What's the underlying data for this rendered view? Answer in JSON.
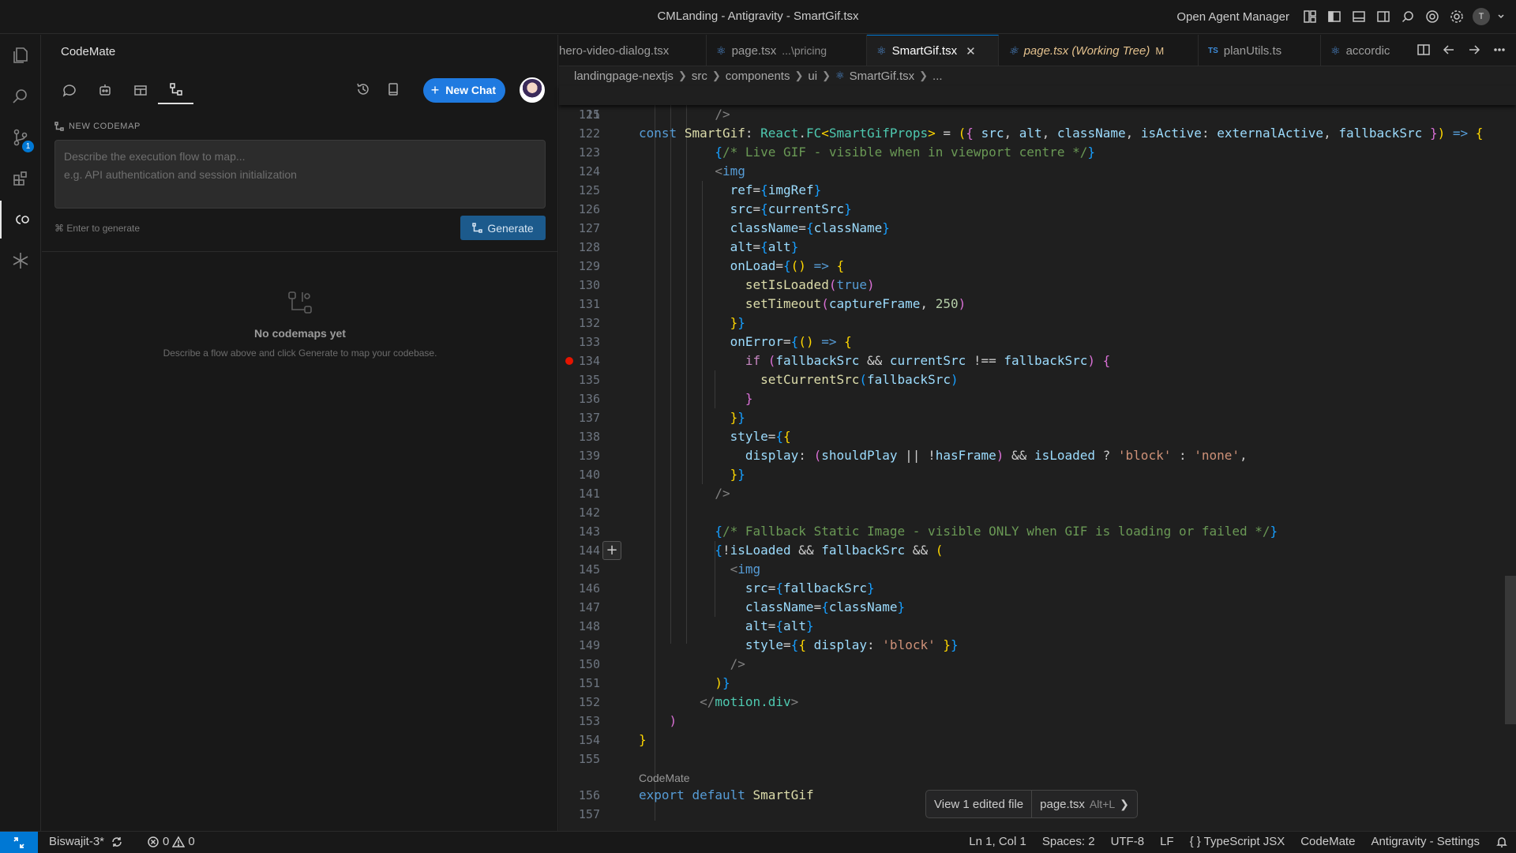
{
  "window": {
    "title": "CMLanding - Antigravity - SmartGif.tsx",
    "agent_manager_label": "Open Agent Manager",
    "account_initial": "T"
  },
  "activity_bar": {
    "items": [
      "files-icon",
      "search-icon",
      "source-control-icon",
      "extensions-icon",
      "codemate-icon",
      "asterisk-icon"
    ],
    "source_control_badge": "1"
  },
  "codemate": {
    "panel_title": "CodeMate",
    "new_chat_label": "New Chat",
    "section_label": "NEW CODEMAP",
    "input_placeholder_1": "Describe the execution flow to map...",
    "input_placeholder_2": "e.g. API authentication and session initialization",
    "enter_hint": "⌘ Enter to generate",
    "generate_label": "Generate",
    "empty_title": "No codemaps yet",
    "empty_subtitle": "Describe a flow above and click Generate to map your codebase."
  },
  "editor": {
    "tabs": [
      {
        "label": "hero-video-dialog.tsx",
        "desc": ""
      },
      {
        "label": "page.tsx",
        "desc": "...\\pricing"
      },
      {
        "label": "SmartGif.tsx",
        "desc": ""
      },
      {
        "label": "page.tsx (Working Tree)",
        "desc": "M"
      },
      {
        "label": "planUtils.ts",
        "desc": ""
      },
      {
        "label": "accordic",
        "desc": ""
      }
    ],
    "breadcrumb": [
      "landingpage-nextjs",
      "src",
      "components",
      "ui",
      "SmartGif.tsx",
      "..."
    ],
    "codelens": "CodeMate",
    "edited_files_label": "View 1 edited file",
    "edited_file_name": "page.tsx",
    "edited_file_shortcut": "Alt+L",
    "line_numbers": [
      "15",
      "121",
      "122",
      "123",
      "124",
      "125",
      "126",
      "127",
      "128",
      "129",
      "130",
      "131",
      "132",
      "133",
      "134",
      "135",
      "136",
      "137",
      "138",
      "139",
      "140",
      "141",
      "142",
      "143",
      "144",
      "145",
      "146",
      "147",
      "148",
      "149",
      "150",
      "151",
      "152",
      "153",
      "154",
      "155",
      "156",
      "157"
    ]
  },
  "status_bar": {
    "branch": "Biswajit-3*",
    "errors": "0",
    "warnings": "0",
    "position": "Ln 1, Col 1",
    "spaces": "Spaces: 2",
    "encoding": "UTF-8",
    "eol": "LF",
    "language": "TypeScript JSX",
    "codemate": "CodeMate",
    "settings": "Antigravity - Settings"
  },
  "colors": {
    "accent": "#0078d4",
    "new_chat_button": "#1f7ae0",
    "generate_button": "#1c5a8c",
    "breakpoint": "#e51400",
    "modified_tab": "#e2c08d"
  }
}
